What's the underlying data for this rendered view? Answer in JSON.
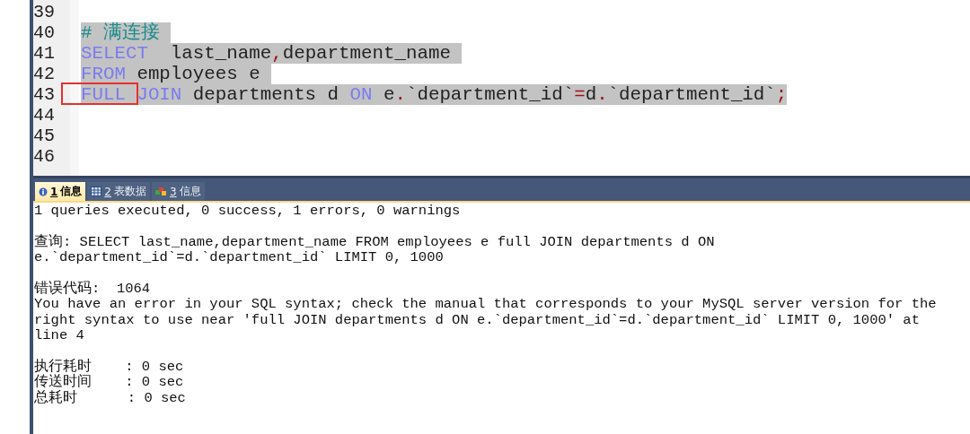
{
  "editor": {
    "lines": [
      {
        "number": "39"
      },
      {
        "number": "40",
        "selected": true,
        "tokens": [
          {
            "kind": "comment",
            "text": "# 满连接 "
          }
        ]
      },
      {
        "number": "41",
        "selected": true,
        "tokens": [
          {
            "kind": "keyword",
            "text": "SELECT"
          },
          {
            "kind": "text",
            "text": "  last_name"
          },
          {
            "kind": "punct",
            "text": ","
          },
          {
            "kind": "text",
            "text": "department_name "
          }
        ]
      },
      {
        "number": "42",
        "selected": true,
        "tokens": [
          {
            "kind": "keyword",
            "text": "FROM"
          },
          {
            "kind": "text",
            "text": " employees e "
          }
        ]
      },
      {
        "number": "43",
        "selected": true,
        "boxed": true,
        "tokens": [
          {
            "kind": "keyword",
            "text": "FULL "
          },
          {
            "kind": "keyword",
            "text": "JOIN"
          },
          {
            "kind": "text",
            "text": " departments d "
          },
          {
            "kind": "keyword",
            "text": "ON"
          },
          {
            "kind": "text",
            "text": " e"
          },
          {
            "kind": "punct",
            "text": "."
          },
          {
            "kind": "text",
            "text": "`department_id`"
          },
          {
            "kind": "punct",
            "text": "="
          },
          {
            "kind": "text",
            "text": "d"
          },
          {
            "kind": "punct",
            "text": "."
          },
          {
            "kind": "text",
            "text": "`department_id`"
          },
          {
            "kind": "punct",
            "text": ";"
          }
        ]
      },
      {
        "number": "44"
      },
      {
        "number": "45"
      },
      {
        "number": "46"
      }
    ]
  },
  "tabs": [
    {
      "kind": "info",
      "number": "1",
      "label": "信息",
      "selected": true
    },
    {
      "kind": "grid",
      "number": "2",
      "label": "表数据",
      "selected": false
    },
    {
      "kind": "blocks",
      "number": "3",
      "label": "信息",
      "selected": false
    }
  ],
  "output": [
    [
      "1 queries executed, 0 success, 1 errors, 0 warnings"
    ],
    [
      "查询: SELECT last_name,department_name FROM employees e full JOIN departments d ON",
      "e.`department_id`=d.`department_id` LIMIT 0, 1000"
    ],
    [
      "错误代码:  1064",
      "You have an error in your SQL syntax; check the manual that corresponds to your MySQL server version for the",
      "right syntax to use near 'full JOIN departments d ON e.`department_id`=d.`department_id` LIMIT 0, 1000' at",
      "line 4"
    ],
    [
      "执行耗时    : 0 sec",
      "传送时间    : 0 sec",
      "总耗时      : 0 sec"
    ]
  ]
}
